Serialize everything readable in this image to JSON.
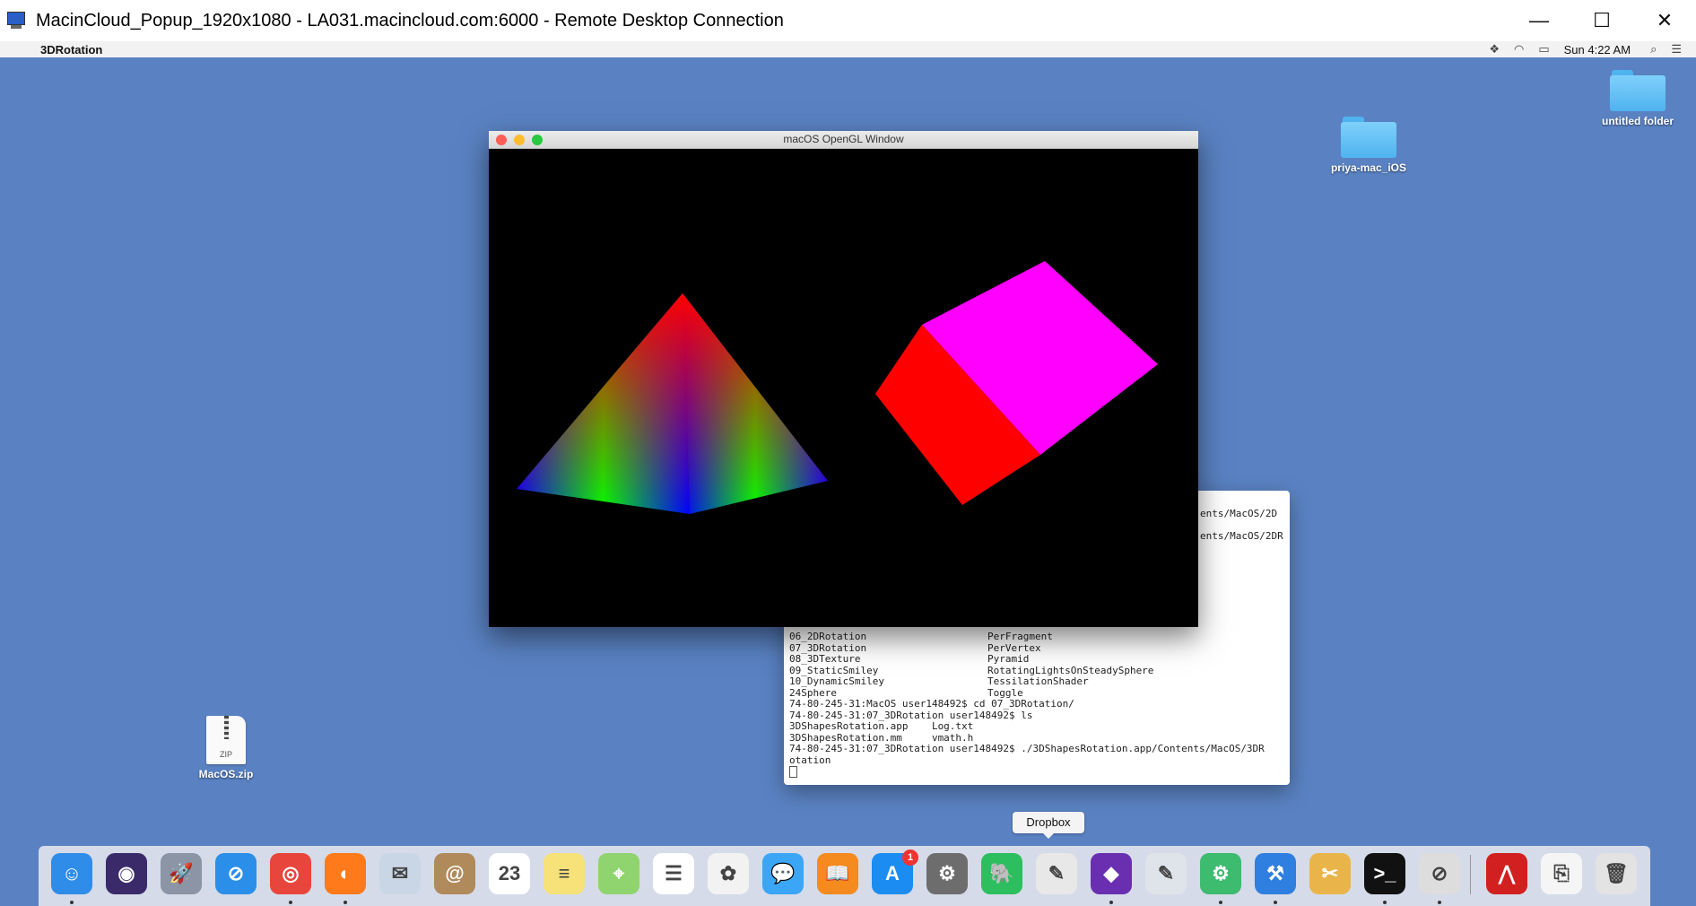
{
  "rdp": {
    "title": "MacinCloud_Popup_1920x1080 - LA031.macincloud.com:6000 - Remote Desktop Connection",
    "minimize": "—",
    "maximize": "☐",
    "close": "✕"
  },
  "menubar": {
    "app_name": "3DRotation",
    "clock": "Sun 4:22 AM",
    "icons": [
      "dropbox-icon",
      "wifi-icon",
      "airplay-icon",
      "spotlight-icon",
      "notification-center-icon"
    ]
  },
  "desktop": {
    "items": [
      {
        "label": "untitled folder",
        "type": "folder"
      },
      {
        "label": "priya-mac_iOS",
        "type": "folder"
      },
      {
        "label": "MacOS.zip",
        "type": "zip",
        "badge": "ZIP"
      }
    ]
  },
  "gl_window": {
    "title": "macOS OpenGL Window",
    "colors": {
      "apex": "#ff0000",
      "left": "#0000ff",
      "right": "#00ff00",
      "cube_front": "#ff0000",
      "cube_top": "#ff00ff"
    }
  },
  "terminal": {
    "right_fragments": [
      "ents/MacOS/2D",
      "ents/MacOS/2DR"
    ],
    "lines": [
      {
        "left": "06_2DRotation",
        "right": "PerFragment"
      },
      {
        "left": "07_3DRotation",
        "right": "PerVertex"
      },
      {
        "left": "08_3DTexture",
        "right": "Pyramid"
      },
      {
        "left": "09_StaticSmiley",
        "right": "RotatingLightsOnSteadySphere"
      },
      {
        "left": "10_DynamicSmiley",
        "right": "TessilationShader"
      },
      {
        "left": "24Sphere",
        "right": "Toggle"
      }
    ],
    "commands": [
      "74-80-245-31:MacOS user148492$ cd 07_3DRotation/",
      "74-80-245-31:07_3DRotation user148492$ ls",
      "3DShapesRotation.app    Log.txt",
      "3DShapesRotation.mm     vmath.h",
      "74-80-245-31:07_3DRotation user148492$ ./3DShapesRotation.app/Contents/MacOS/3DR",
      "otation"
    ]
  },
  "tooltip": {
    "text": "Dropbox"
  },
  "dock": {
    "items": [
      {
        "name": "finder-icon",
        "bg": "#2f8ce8",
        "glyph": "☺",
        "running": true
      },
      {
        "name": "siri-icon",
        "bg": "#3a2a6a",
        "glyph": "◉",
        "running": false
      },
      {
        "name": "launchpad-icon",
        "bg": "#8b95a5",
        "glyph": "🚀",
        "running": false
      },
      {
        "name": "safari-icon",
        "bg": "#2b8ee8",
        "glyph": "⊘",
        "running": false
      },
      {
        "name": "chrome-icon",
        "bg": "#e8453c",
        "glyph": "◎",
        "running": true
      },
      {
        "name": "firefox-icon",
        "bg": "#ff7a1a",
        "glyph": "◐",
        "running": true
      },
      {
        "name": "mail-icon",
        "bg": "#c9d6e6",
        "glyph": "✉",
        "running": false
      },
      {
        "name": "contacts-icon",
        "bg": "#b08a5a",
        "glyph": "@",
        "running": false
      },
      {
        "name": "calendar-icon",
        "bg": "#ffffff",
        "glyph": "23",
        "running": false
      },
      {
        "name": "notes-icon",
        "bg": "#f7e27a",
        "glyph": "≡",
        "running": false
      },
      {
        "name": "maps-icon",
        "bg": "#8fd46e",
        "glyph": "⌖",
        "running": false
      },
      {
        "name": "reminders-icon",
        "bg": "#ffffff",
        "glyph": "☰",
        "running": false
      },
      {
        "name": "photos-icon",
        "bg": "#f2f2f2",
        "glyph": "✿",
        "running": false
      },
      {
        "name": "messages-icon",
        "bg": "#3aa6f5",
        "glyph": "💬",
        "running": false
      },
      {
        "name": "books-icon",
        "bg": "#f58a1f",
        "glyph": "📖",
        "running": false
      },
      {
        "name": "app-store-icon",
        "bg": "#1b8cf2",
        "glyph": "A",
        "running": false,
        "badge": "1"
      },
      {
        "name": "system-preferences-icon",
        "bg": "#6d6d6d",
        "glyph": "⚙",
        "running": false
      },
      {
        "name": "evernote-icon",
        "bg": "#2dbe60",
        "glyph": "🐘",
        "running": false
      },
      {
        "name": "textedit-icon",
        "bg": "#e8e8e8",
        "glyph": "✎",
        "running": false
      },
      {
        "name": "visual-studio-icon",
        "bg": "#6a2fb0",
        "glyph": "◆",
        "running": true
      },
      {
        "name": "instruments-icon",
        "bg": "#dfe4ea",
        "glyph": "✎",
        "running": false
      },
      {
        "name": "android-studio-icon",
        "bg": "#3dbb6e",
        "glyph": "⚙",
        "running": true
      },
      {
        "name": "xcode-icon",
        "bg": "#2f7fe0",
        "glyph": "⚒",
        "running": true
      },
      {
        "name": "archive-utility-icon",
        "bg": "#e9b54a",
        "glyph": "✂",
        "running": false
      },
      {
        "name": "terminal-icon",
        "bg": "#111111",
        "glyph": ">_",
        "running": true
      },
      {
        "name": "blocked-app-icon",
        "bg": "#dddddd",
        "glyph": "⊘",
        "running": true
      },
      {
        "name": "acrobat-icon",
        "bg": "#d22020",
        "glyph": "⋀",
        "running": false
      },
      {
        "name": "zip-file-icon",
        "bg": "#f5f5f5",
        "glyph": "⎘",
        "running": false
      },
      {
        "name": "trash-icon",
        "bg": "#e3e3e3",
        "glyph": "🗑",
        "running": false
      }
    ]
  }
}
